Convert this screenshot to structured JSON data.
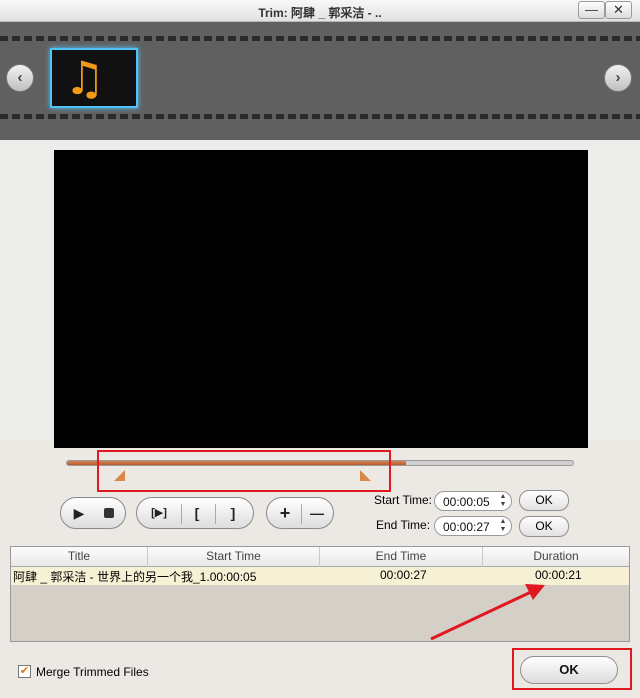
{
  "window": {
    "title": "Trim: 阿肆 _ 郭采洁 - ..",
    "min_glyph": "—",
    "close_glyph": "✕"
  },
  "filmstrip": {
    "thumb_icon": "music-note-icon",
    "thumb_glyph": "♫",
    "prev_glyph": "‹",
    "next_glyph": "›"
  },
  "timeline": {
    "progress_fraction": 0.67,
    "fill_color": "#c96a3c"
  },
  "controls": {
    "play_glyph": "▶",
    "clip_glyph": "[▶]",
    "mark_in_glyph": "[",
    "mark_out_glyph": "]",
    "add_glyph": "+",
    "remove_glyph": "—"
  },
  "trim": {
    "start_label": "Start Time:",
    "start_value": "00:00:05",
    "end_label": "End Time:",
    "end_value": "00:00:27",
    "ok_label": "OK"
  },
  "table": {
    "columns": [
      "Title",
      "Start Time",
      "End Time",
      "Duration"
    ],
    "rows": [
      {
        "title": "阿肆 _ 郭采洁 - 世界上的另一个我_1.00:00:05",
        "end": "00:00:27",
        "duration": "00:00:21"
      }
    ]
  },
  "footer": {
    "merge_label": "Merge Trimmed Files",
    "merge_checked": true,
    "check_glyph": "✔",
    "ok_label": "OK"
  },
  "colors": {
    "highlight_red": "#e0181f",
    "accent_orange": "#d9884a",
    "thumb_border": "#4fc3f7"
  }
}
